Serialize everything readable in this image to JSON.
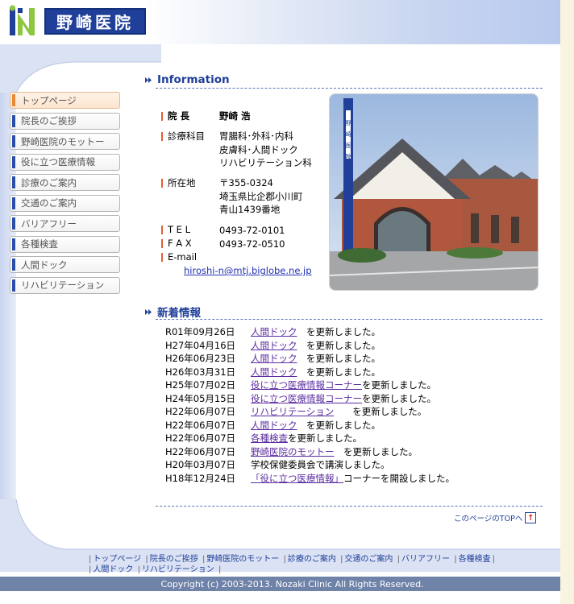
{
  "header": {
    "logo_text": "野崎医院"
  },
  "nav": [
    {
      "label": "トップページ",
      "active": true
    },
    {
      "label": "院長のご挨拶",
      "active": false
    },
    {
      "label": "野崎医院のモットー",
      "active": false
    },
    {
      "label": "役に立つ医療情報",
      "active": false
    },
    {
      "label": "診療のご案内",
      "active": false
    },
    {
      "label": "交通のご案内",
      "active": false
    },
    {
      "label": "バリアフリー",
      "active": false
    },
    {
      "label": "各種検査",
      "active": false
    },
    {
      "label": "人間ドック",
      "active": false
    },
    {
      "label": "リハビリテーション",
      "active": false
    }
  ],
  "information": {
    "heading": "Information",
    "director_label": "院 長",
    "director_value": "野崎 浩",
    "departments_label": "診療科目",
    "departments": [
      "胃腸科･外科･内科",
      "皮膚科･人間ドック",
      "リハビリテーション科"
    ],
    "address_label": "所在地",
    "address": [
      "〒355-0324",
      "埼玉県比企郡小川町",
      "青山1439番地"
    ],
    "tel_label": "T E L",
    "tel": "0493-72-0101",
    "fax_label": "F A X",
    "fax": "0493-72-0510",
    "email_label": "E-mail",
    "email": "hiroshi-n@mtj.biglobe.ne.jp",
    "sign_text": "野崎医院"
  },
  "news": {
    "heading": "新着情報",
    "items": [
      {
        "date": "R01年09月26日",
        "link": "人間ドック",
        "pad": "　",
        "text": "を更新しました。"
      },
      {
        "date": "H27年04月16日",
        "link": "人間ドック",
        "pad": "　",
        "text": "を更新しました。"
      },
      {
        "date": "H26年06月23日",
        "link": "人間ドック",
        "pad": "　",
        "text": "を更新しました。"
      },
      {
        "date": "H26年03月31日",
        "link": "人間ドック",
        "pad": "　",
        "text": "を更新しました。"
      },
      {
        "date": "H25年07月02日",
        "link": "役に立つ医療情報コーナー",
        "pad": "",
        "text": "を更新しました。"
      },
      {
        "date": "H24年05月15日",
        "link": "役に立つ医療情報コーナー",
        "pad": "",
        "text": "を更新しました。"
      },
      {
        "date": "H22年06月07日",
        "link": "リハビリテーション",
        "pad": "　　",
        "text": "を更新しました。"
      },
      {
        "date": "H22年06月07日",
        "link": "人間ドック",
        "pad": "　",
        "text": "を更新しました。"
      },
      {
        "date": "H22年06月07日",
        "link": "各種検査",
        "pad": "",
        "text": "を更新しました。"
      },
      {
        "date": "H22年06月07日",
        "link": "野崎医院のモットー",
        "pad": "　",
        "text": "を更新しました。"
      },
      {
        "date": "H20年03月07日",
        "link": "",
        "pad": "",
        "text": "学校保健委員会で講演しました。"
      },
      {
        "date": "H18年12月24日",
        "link": "「役に立つ医療情報」",
        "pad": "",
        "text": "コーナーを開設しました。"
      }
    ]
  },
  "to_top": "このページのTOPへ",
  "to_top_icon": "up-arrow-icon",
  "footer": {
    "links": [
      "トップページ",
      "院長のご挨拶",
      "野崎医院のモットー",
      "診療のご案内",
      "交通のご案内",
      "バリアフリー",
      "各種検査",
      "人間ドック",
      "リハビリテーション"
    ],
    "copyright": "Copyright (c) 2003-2013. Nozaki Clinic All Rights Reserved."
  },
  "colors": {
    "brand_blue": "#1f3f98",
    "accent_orange": "#e88a36",
    "accent_green": "#8dc63f",
    "footer_bar": "#6f82a8"
  }
}
